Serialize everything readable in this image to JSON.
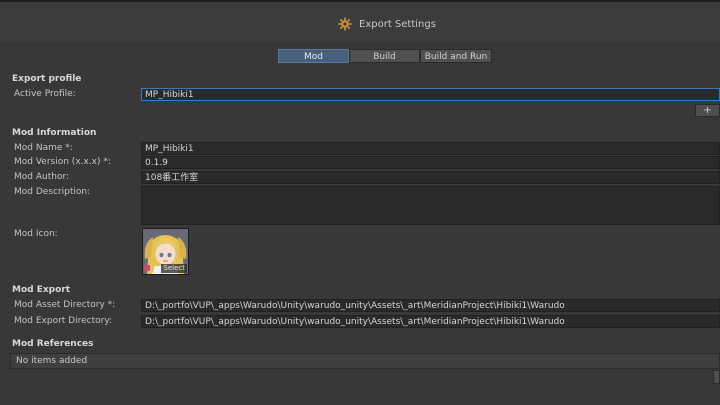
{
  "window": {
    "title": "Export Settings",
    "icon": "gear-icon"
  },
  "tabs": [
    {
      "label": "Mod",
      "active": true
    },
    {
      "label": "Build",
      "active": false
    },
    {
      "label": "Build and Run",
      "active": false
    }
  ],
  "export_profile": {
    "heading": "Export profile",
    "active_profile_label": "Active Profile:",
    "active_profile_value": "MP_Hibiki1",
    "add_button": "+"
  },
  "mod_information": {
    "heading": "Mod Information",
    "name_label": "Mod Name *:",
    "name_value": "MP_Hibiki1",
    "version_label": "Mod Version (x.x.x) *:",
    "version_value": "0.1.9",
    "author_label": "Mod Author:",
    "author_value": "108番工作室",
    "description_label": "Mod Description:",
    "description_value": "",
    "icon_label": "Mod Icon:",
    "icon_select": "Select"
  },
  "mod_export": {
    "heading": "Mod Export",
    "asset_dir_label": "Mod Asset Directory *:",
    "asset_dir_value": "D:\\_portfo\\VUP\\_apps\\Warudo\\Unity\\warudo_unity\\Assets\\_art\\MeridianProject\\Hibiki1\\Warudo",
    "export_dir_label": "Mod Export Directory:",
    "export_dir_value": "D:\\_portfo\\VUP\\_apps\\Warudo\\Unity\\warudo_unity\\Assets\\_art\\MeridianProject\\Hibiki1\\Warudo"
  },
  "mod_references": {
    "heading": "Mod References",
    "empty_text": "No items added"
  },
  "colors": {
    "background": "#383838",
    "field": "#2a2a2a",
    "active_tab": "#46607c",
    "focus_border": "#3a79bb"
  }
}
